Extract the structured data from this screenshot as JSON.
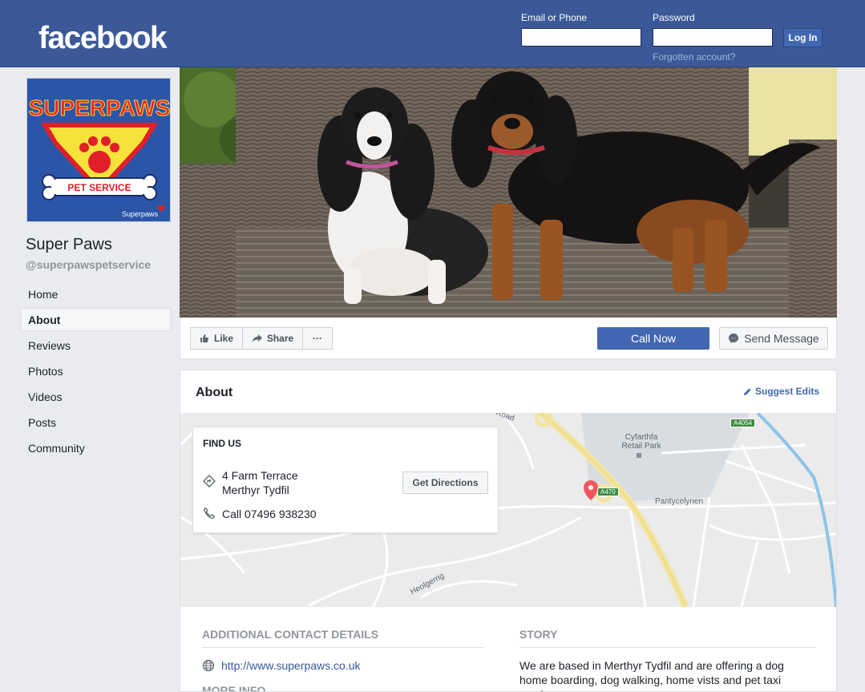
{
  "header": {
    "logo": "facebook",
    "email_label": "Email or Phone",
    "password_label": "Password",
    "login_button": "Log In",
    "forgot_link": "Forgotten account?"
  },
  "page": {
    "name": "Super Paws",
    "handle": "@superpawspetservice",
    "logo_text": "SUPERPAWS",
    "logo_banner": "PET SERVICE",
    "logo_signature": "Superpaws"
  },
  "nav": [
    "Home",
    "About",
    "Reviews",
    "Photos",
    "Videos",
    "Posts",
    "Community"
  ],
  "actions": {
    "like": "Like",
    "share": "Share",
    "more": "···",
    "call_now": "Call Now",
    "send_message": "Send Message"
  },
  "about": {
    "title": "About",
    "suggest_edits": "Suggest Edits",
    "find_us": {
      "title": "FIND US",
      "address_line1": "4 Farm Terrace",
      "address_line2": "Merthyr Tydfil",
      "phone": "Call 07496 938230",
      "directions": "Get Directions"
    },
    "map_labels": {
      "retail_park_line1": "Cyfarthfa",
      "retail_park_line2": "Retail Park",
      "road_a470": "A470",
      "road_a4054": "A4054",
      "street_pantycelynen": "Pantycelynen",
      "street_heolgerrig": "Heolgerrig",
      "street_road": "Road"
    },
    "additional": {
      "title": "ADDITIONAL CONTACT DETAILS",
      "website": "http://www.superpaws.co.uk",
      "more_info": "MORE INFO"
    },
    "story": {
      "title": "STORY",
      "text": "We are based in Merthyr Tydfil and are offering a dog home boarding, dog walking, home vists and pet taxi service."
    }
  },
  "colors": {
    "brand": "#3b5998",
    "button_blue": "#4267b2",
    "link": "#365899",
    "muted": "#90949c"
  }
}
